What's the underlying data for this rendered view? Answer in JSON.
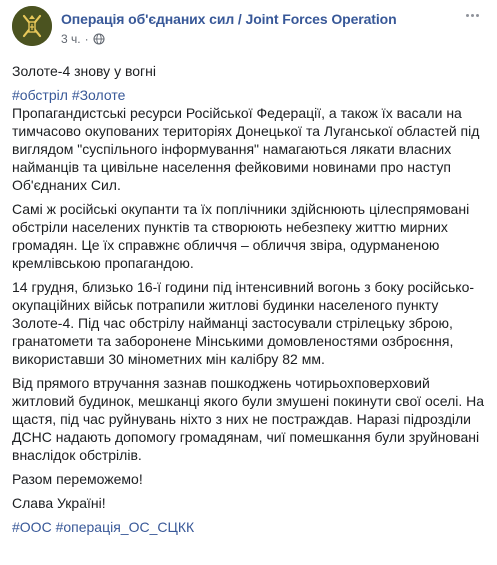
{
  "post": {
    "page_name": "Операція об'єднаних сил / Joint Forces Operation",
    "timestamp": "3 ч.",
    "separator": "·",
    "privacy_icon": "globe-icon",
    "more_icon": "more-horizontal-icon",
    "headline": "Золоте-4 знову у вогні",
    "hashtags_top": [
      "#обстріл",
      "#Золоте"
    ],
    "paragraphs": [
      "Пропагандистські ресурси Російської Федерації, а також їх васали на тимчасово окупованих територіях Донецької та Луганської областей під виглядом \"суспільного інформування\" намагаються лякати власних найманців та цивільне населення фейковими новинами про наступ Об'єднаних Сил.",
      "Самі ж російські окупанти та їх поплічники здійснюють цілеспрямовані обстріли населених пунктів та створюють небезпеку життю мирних громадян. Це їх справжнє обличчя – обличчя звіра, одурманеною кремлівською пропагандою.",
      "14 грудня, близько 16-ї години під інтенсивний вогонь з боку російсько-окупаційних військ потрапили житлові будинки населеного пункту Золоте-4. Під час обстрілу найманці застосували стрілецьку зброю, гранатомети та заборонене Мінськими домовленостями озброєння, використавши 30 мінометних мін калібру 82 мм.",
      "Від прямого втручання зазнав пошкоджень чотирьохповерховий житловий будинок, мешканці якого були змушені покинути свої оселі. На щастя, під час руйнувань ніхто з них не постраждав. Наразі підрозділи ДСНС надають допомогу громадянам, чиї помешкання були зруйновані внаслідок обстрілів.",
      "Разом переможемо!",
      "Слава Україні!"
    ],
    "hashtags_bottom": [
      "#ООС",
      "#операція_ОС_СЦКК"
    ]
  },
  "colors": {
    "link": "#385898",
    "text": "#1c1e21",
    "meta": "#616770",
    "avatar_bg": "#4b5320",
    "avatar_emblem": "#e8c85a"
  }
}
